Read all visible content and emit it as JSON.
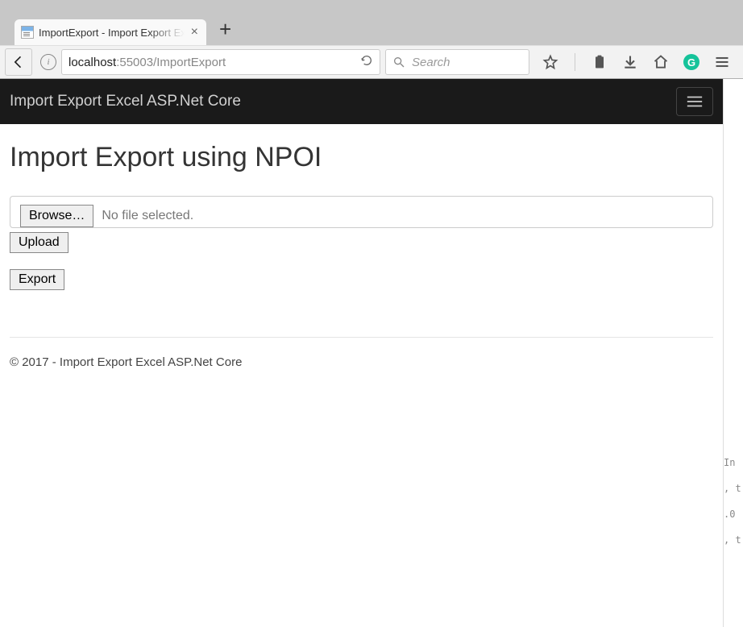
{
  "window": {
    "tab_title": "ImportExport - Import Export Excel ASP.Net Core"
  },
  "browser": {
    "url_host": "localhost",
    "url_port": ":55003",
    "url_path": "/ImportExport",
    "search_placeholder": "Search"
  },
  "page": {
    "navbar_brand": "Import Export Excel ASP.Net Core",
    "heading": "Import Export using NPOI",
    "browse_label": "Browse…",
    "file_status": "No file selected.",
    "upload_label": "Upload",
    "export_label": "Export",
    "footer": "© 2017 - Import Export Excel ASP.Net Core"
  },
  "gutter": {
    "l1": "In",
    "l2": "",
    "l3": ", t",
    "l4": ".0",
    "l5": ", t"
  }
}
